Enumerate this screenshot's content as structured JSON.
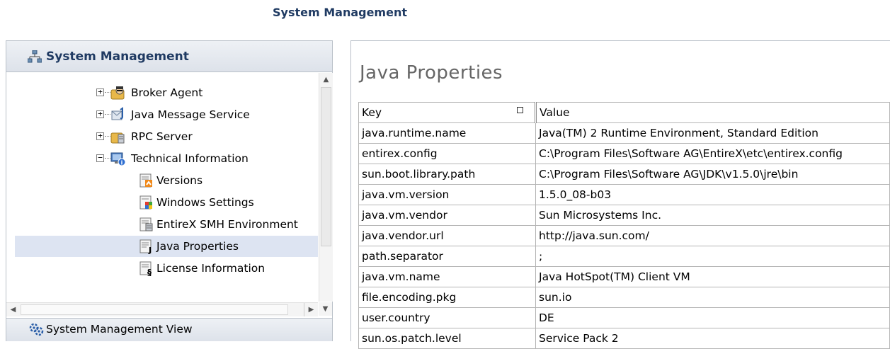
{
  "page_title": "System Management",
  "left_panel": {
    "header_label": "System Management",
    "footer_label": "System Management View",
    "tree": [
      {
        "label": "Broker Agent",
        "toggle": "+",
        "icon": "broker-agent-icon",
        "level": 1
      },
      {
        "label": "Java Message Service",
        "toggle": "+",
        "icon": "jms-icon",
        "level": 1
      },
      {
        "label": "RPC Server",
        "toggle": "+",
        "icon": "rpc-server-icon",
        "level": 1
      },
      {
        "label": "Technical Information",
        "toggle": "−",
        "icon": "technical-info-icon",
        "level": 1
      },
      {
        "label": "Versions",
        "icon": "versions-icon",
        "level": 2
      },
      {
        "label": "Windows Settings",
        "icon": "windows-settings-icon",
        "level": 2
      },
      {
        "label": "EntireX SMH Environment",
        "icon": "smh-environment-icon",
        "level": 2
      },
      {
        "label": "Java Properties",
        "icon": "java-properties-icon",
        "level": 2,
        "selected": true
      },
      {
        "label": "License Information",
        "icon": "license-info-icon",
        "level": 2
      }
    ]
  },
  "content": {
    "title": "Java Properties",
    "table": {
      "headers": [
        "Key",
        "Value"
      ],
      "rows": [
        [
          "java.runtime.name",
          "Java(TM) 2 Runtime Environment, Standard Edition"
        ],
        [
          "entirex.config",
          "C:\\Program Files\\Software AG\\EntireX\\etc\\entirex.config"
        ],
        [
          "sun.boot.library.path",
          "C:\\Program Files\\Software AG\\JDK\\v1.5.0\\jre\\bin"
        ],
        [
          "java.vm.version",
          "1.5.0_08-b03"
        ],
        [
          "java.vm.vendor",
          "Sun Microsystems Inc."
        ],
        [
          "java.vendor.url",
          "http://java.sun.com/"
        ],
        [
          "path.separator",
          ";"
        ],
        [
          "java.vm.name",
          "Java HotSpot(TM) Client VM"
        ],
        [
          "file.encoding.pkg",
          "sun.io"
        ],
        [
          "user.country",
          "DE"
        ],
        [
          "sun.os.patch.level",
          "Service Pack 2"
        ]
      ]
    }
  },
  "colors": {
    "title_blue": "#1f3a62",
    "selection": "#dde4f2",
    "border": "#b9c0c8"
  }
}
